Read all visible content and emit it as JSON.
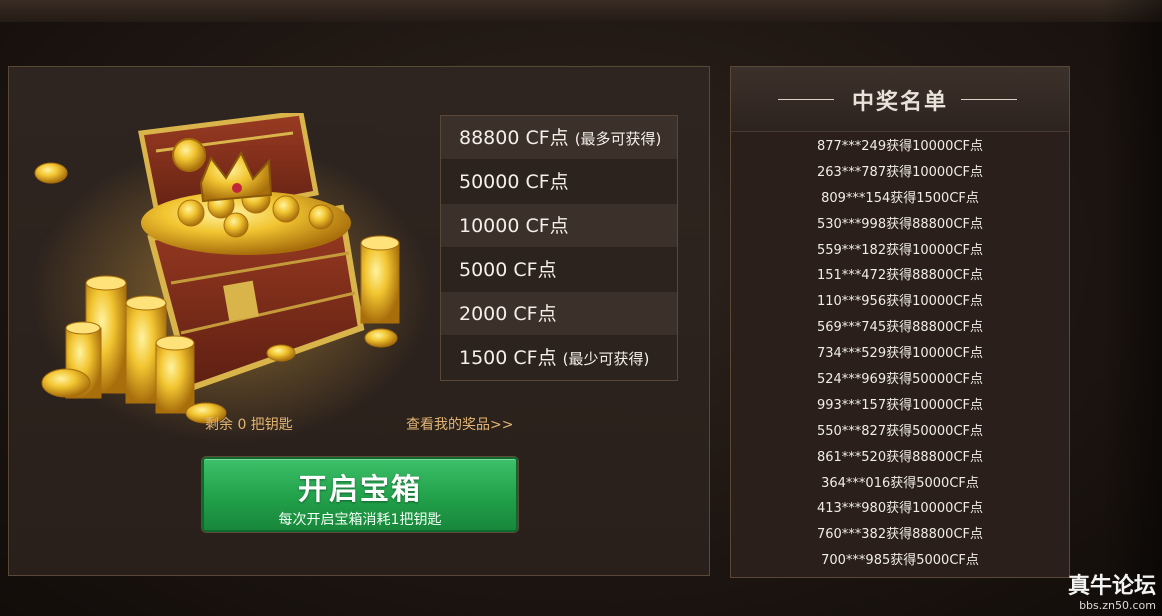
{
  "prizes": [
    {
      "amount": "88800 CF点",
      "note": "(最多可获得)"
    },
    {
      "amount": "50000 CF点",
      "note": ""
    },
    {
      "amount": "10000 CF点",
      "note": ""
    },
    {
      "amount": "5000 CF点",
      "note": ""
    },
    {
      "amount": "2000 CF点",
      "note": ""
    },
    {
      "amount": "1500 CF点",
      "note": "(最少可获得)"
    }
  ],
  "keys_remaining": "剩余 0 把钥匙",
  "my_prizes_link": "查看我的奖品>>",
  "open_button": {
    "title": "开启宝箱",
    "subtitle": "每次开启宝箱消耗1把钥匙"
  },
  "winners": {
    "title": "中奖名单",
    "rows": [
      "877***249获得10000CF点",
      "263***787获得10000CF点",
      "809***154获得1500CF点",
      "530***998获得88800CF点",
      "559***182获得10000CF点",
      "151***472获得88800CF点",
      "110***956获得10000CF点",
      "569***745获得88800CF点",
      "734***529获得10000CF点",
      "524***969获得50000CF点",
      "993***157获得10000CF点",
      "550***827获得50000CF点",
      "861***520获得88800CF点",
      "364***016获得5000CF点",
      "413***980获得10000CF点",
      "760***382获得88800CF点",
      "700***985获得5000CF点"
    ]
  },
  "watermark": {
    "main": "真牛论坛",
    "sub": "bbs.zn50.com"
  },
  "colors": {
    "accent_gold": "#e2b573",
    "button_green": "#22a04a",
    "panel_border": "#5a4836"
  }
}
